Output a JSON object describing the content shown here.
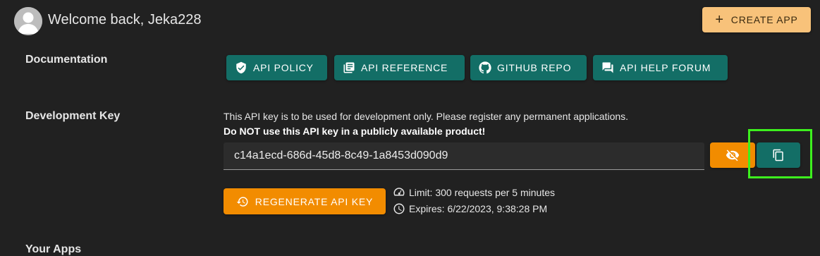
{
  "header": {
    "welcome_text": "Welcome back, Jeka228",
    "create_app_label": "CREATE APP"
  },
  "documentation": {
    "section_label": "Documentation",
    "buttons": [
      {
        "label": "API POLICY",
        "icon": "shield-check-icon"
      },
      {
        "label": "API REFERENCE",
        "icon": "book-icon"
      },
      {
        "label": "GITHUB REPO",
        "icon": "github-icon"
      },
      {
        "label": "API HELP FORUM",
        "icon": "forum-icon"
      }
    ]
  },
  "development_key": {
    "section_label": "Development Key",
    "note_line1": "This API key is to be used for development only. Please register any permanent applications.",
    "note_line2": "Do NOT use this API key in a publicly available product!",
    "api_key_value": "c14a1ecd-686d-45d8-8c49-1a8453d090d9",
    "toggle_visibility_icon": "eye-off-icon",
    "copy_icon": "copy-icon",
    "regenerate_label": "REGENERATE API KEY",
    "limit_text": "Limit: 300 requests per 5 minutes",
    "expires_text": "Expires: 6/22/2023, 9:38:28 PM"
  },
  "your_apps": {
    "section_label": "Your Apps"
  },
  "colors": {
    "background": "#212121",
    "teal": "#136e66",
    "orange": "#f28c00",
    "create_button": "#f8c27a",
    "highlight": "#3df01e"
  }
}
